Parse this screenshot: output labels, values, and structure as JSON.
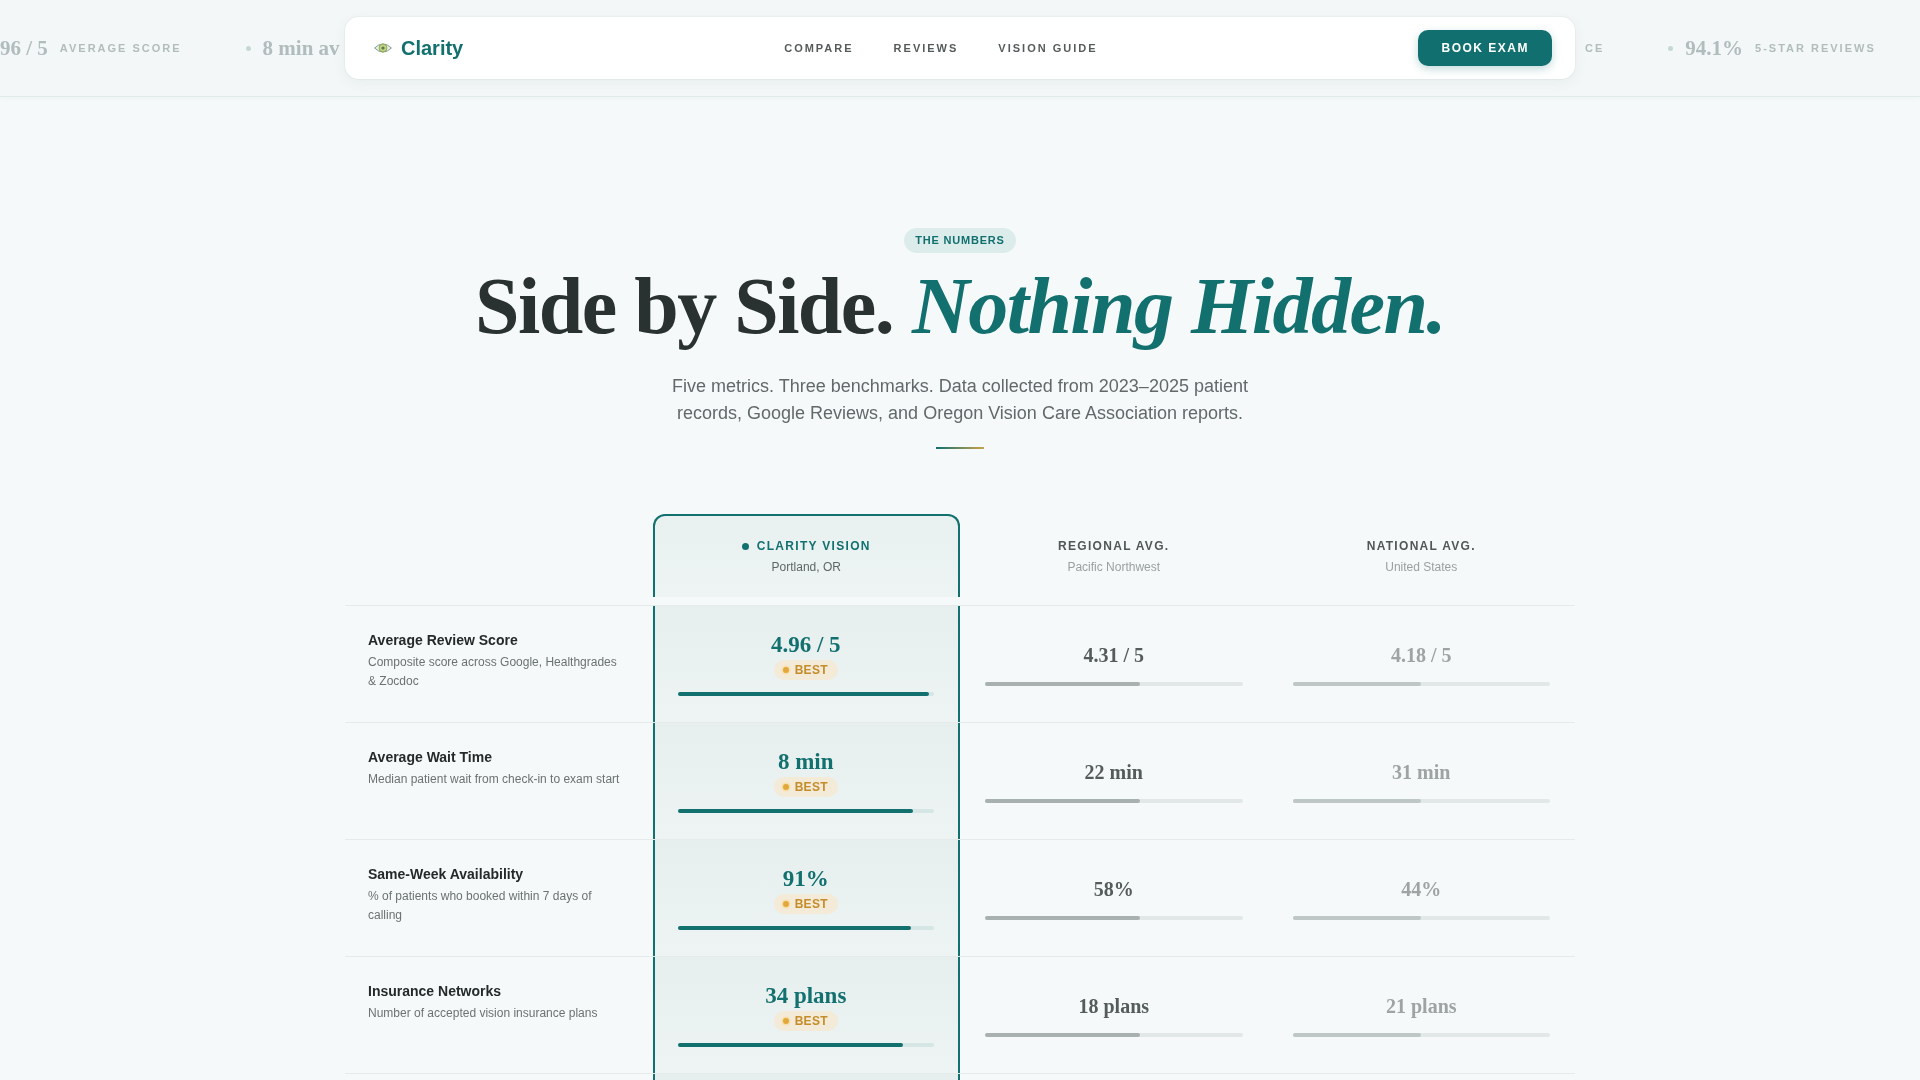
{
  "ticker": {
    "left": [
      {
        "value": "96 / 5",
        "label": "AVERAGE SCORE"
      },
      {
        "value": "8 min av"
      }
    ],
    "right": [
      {
        "label": "CE"
      },
      {
        "value": "94.1%",
        "label": "5-STAR REVIEWS"
      }
    ]
  },
  "nav": {
    "brand": "Clarity",
    "links": [
      "COMPARE",
      "REVIEWS",
      "VISION GUIDE"
    ],
    "cta": "BOOK EXAM"
  },
  "hero": {
    "eyebrow": "THE NUMBERS",
    "title": "Side by Side. *Nothing Hidden.*",
    "subtitle": "Five metrics. Three benchmarks. Data collected from 2023–2025 patient records, Google Reviews, and Oregon Vision Care Association reports."
  },
  "table": {
    "columns": [
      {
        "kind": "primary",
        "title": "CLARITY VISION",
        "subtitle": "Portland, OR"
      },
      {
        "kind": "secondary",
        "title": "REGIONAL AVG.",
        "subtitle": "Pacific Northwest"
      },
      {
        "kind": "tertiary",
        "title": "NATIONAL AVG.",
        "subtitle": "United States"
      }
    ],
    "rows": [
      {
        "metric": "Average Review Score",
        "description": "Composite score across Google, Healthgrades & Zocdoc",
        "cells": [
          {
            "value": "4.96 / 5",
            "badge": "BEST",
            "level": 0.98
          },
          {
            "value": "4.31 / 5",
            "level": 0.6
          },
          {
            "value": "4.18 / 5",
            "level": 0.5
          }
        ]
      },
      {
        "metric": "Average Wait Time",
        "description": "Median patient wait from check-in to exam start",
        "cells": [
          {
            "value": "8 min",
            "badge": "BEST",
            "level": 0.92
          },
          {
            "value": "22 min",
            "level": 0.6
          },
          {
            "value": "31 min",
            "level": 0.5
          }
        ]
      },
      {
        "metric": "Same-Week Availability",
        "description": "% of patients who booked within 7 days of calling",
        "cells": [
          {
            "value": "91%",
            "badge": "BEST",
            "level": 0.91
          },
          {
            "value": "58%",
            "level": 0.6
          },
          {
            "value": "44%",
            "level": 0.5
          }
        ]
      },
      {
        "metric": "Insurance Networks",
        "description": "Number of accepted vision insurance plans",
        "cells": [
          {
            "value": "34 plans",
            "badge": "BEST",
            "level": 0.88
          },
          {
            "value": "18 plans",
            "level": 0.6
          },
          {
            "value": "21 plans",
            "level": 0.5
          }
        ]
      }
    ]
  }
}
